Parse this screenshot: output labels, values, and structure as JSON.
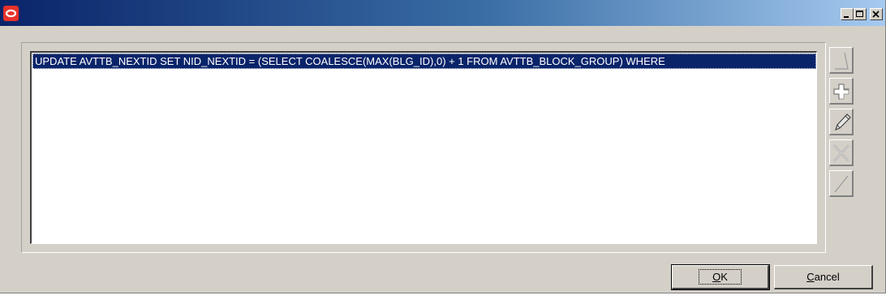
{
  "window": {
    "title": "",
    "icon": "oracle-logo-icon",
    "controls": [
      "minimize-icon",
      "maximize-icon",
      "close-icon"
    ]
  },
  "list": {
    "rows": [
      "UPDATE AVTTB_NEXTID SET NID_NEXTID = (SELECT COALESCE(MAX(BLG_ID),0) + 1 FROM AVTTB_BLOCK_GROUP) WHERE"
    ],
    "selected_index": 0
  },
  "side_buttons": [
    {
      "icon": "first-icon",
      "enabled": false
    },
    {
      "icon": "add-icon",
      "enabled": true
    },
    {
      "icon": "edit-pencil-icon",
      "enabled": true
    },
    {
      "icon": "delete-icon",
      "enabled": false
    },
    {
      "icon": "last-icon",
      "enabled": false
    }
  ],
  "buttons": {
    "ok_first": "O",
    "ok_rest": "K",
    "cancel_first": "C",
    "cancel_rest": "ancel"
  },
  "colors": {
    "title_start": "#0a246a",
    "title_end": "#a6caf0",
    "selection": "#0a246a",
    "face": "#d4d0c8"
  }
}
